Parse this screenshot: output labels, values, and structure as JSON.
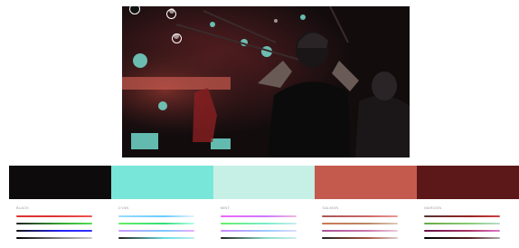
{
  "swatches": [
    {
      "name": "black",
      "hex": "#0d0b0c",
      "label": "BLACK"
    },
    {
      "name": "cyan",
      "hex": "#78e6d8",
      "label": "CYAN"
    },
    {
      "name": "mint",
      "hex": "#c6efe6",
      "label": "MINT"
    },
    {
      "name": "salmon",
      "hex": "#c45a4e",
      "label": "SALMON"
    },
    {
      "name": "maroon",
      "hex": "#5c1819",
      "label": "MAROON"
    }
  ],
  "channels": [
    "H",
    "S",
    "B",
    "A"
  ],
  "picker_markers": [
    {
      "name": "picker-dot-black",
      "color": "#111111"
    },
    {
      "name": "picker-dot-cyan",
      "color": "#ffffff"
    },
    {
      "name": "picker-dot-salmon",
      "color": "#ffffff"
    }
  ]
}
